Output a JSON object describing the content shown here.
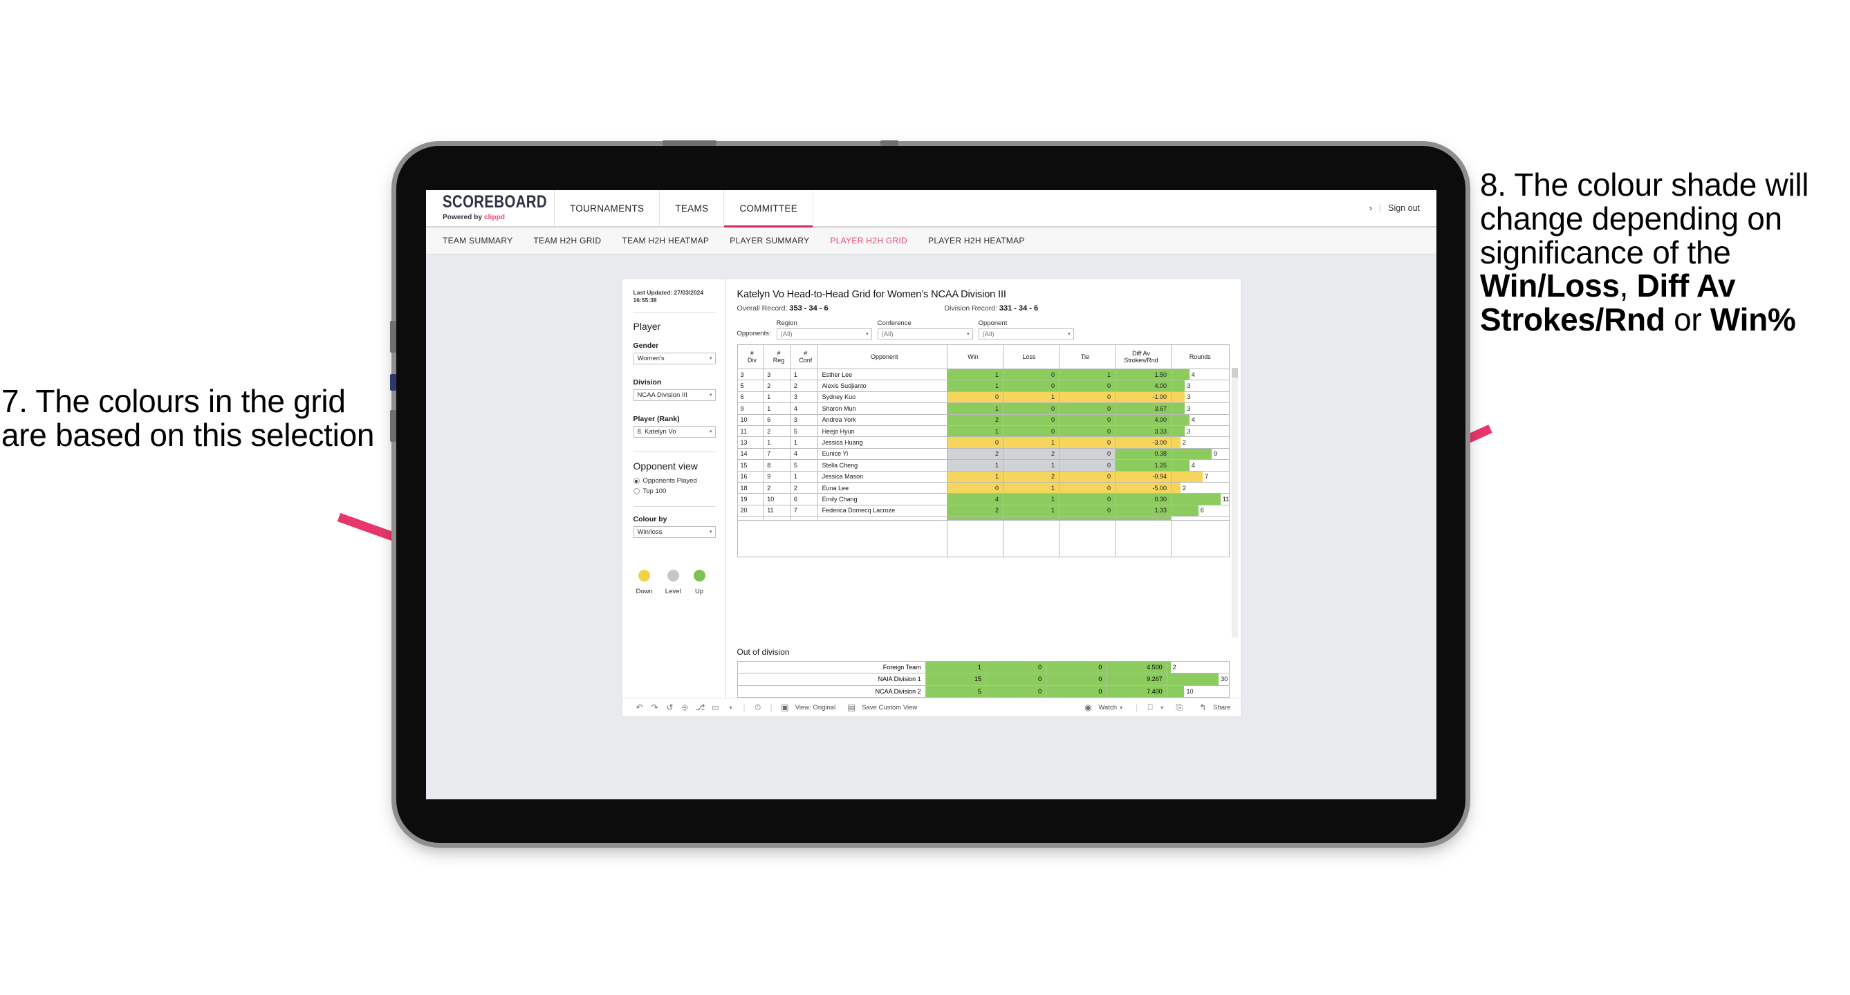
{
  "annotations": {
    "left": "7. The colours in the grid are based on this selection",
    "right_pre": "8. The colour shade will change depending on significance of the ",
    "right_b1": "Win/Loss",
    "right_mid1": ", ",
    "right_b2": "Diff Av Strokes/Rnd",
    "right_mid2": " or ",
    "right_b3": "Win%",
    "arrow_color": "#e8366b"
  },
  "topnav": {
    "brand_title": "SCOREBOARD",
    "brand_sub_prefix": "Powered by ",
    "brand_sub_name": "clippd",
    "items": [
      {
        "label": "TOURNAMENTS",
        "active": false
      },
      {
        "label": "TEAMS",
        "active": false
      },
      {
        "label": "COMMITTEE",
        "active": true
      }
    ],
    "chevron": "›",
    "divider": "|",
    "signout": "Sign out"
  },
  "subnav": {
    "items": [
      {
        "label": "TEAM SUMMARY",
        "active": false
      },
      {
        "label": "TEAM H2H GRID",
        "active": false
      },
      {
        "label": "TEAM H2H HEATMAP",
        "active": false
      },
      {
        "label": "PLAYER SUMMARY",
        "active": false
      },
      {
        "label": "PLAYER H2H GRID",
        "active": true
      },
      {
        "label": "PLAYER H2H HEATMAP",
        "active": false
      }
    ]
  },
  "panel": {
    "last_updated": "Last Updated: 27/03/2024 16:55:38",
    "player_heading": "Player",
    "gender_label": "Gender",
    "gender_value": "Women's",
    "division_label": "Division",
    "division_value": "NCAA Division III",
    "player_rank_label": "Player (Rank)",
    "player_rank_value": "8. Katelyn Vo",
    "opponent_view_heading": "Opponent view",
    "opponent_view_options": [
      {
        "label": "Opponents Played",
        "selected": true
      },
      {
        "label": "Top 100",
        "selected": false
      }
    ],
    "colour_by_label": "Colour by",
    "colour_by_value": "Win/loss",
    "legend": [
      {
        "label": "Down",
        "color": "#f2d247"
      },
      {
        "label": "Level",
        "color": "#c4c8cb"
      },
      {
        "label": "Up",
        "color": "#7cc253"
      }
    ],
    "caret": "▾"
  },
  "main": {
    "title": "Katelyn Vo Head-to-Head Grid for Women’s NCAA Division III",
    "overall_record_label": "Overall Record: ",
    "overall_record_value": "353 - 34 - 6",
    "division_record_label": "Division Record: ",
    "division_record_value": "331 - 34 - 6",
    "opponents_label": "Opponents:",
    "opp_filters": [
      {
        "caption": "Region",
        "value": "(All)"
      },
      {
        "caption": "Conference",
        "value": "(All)"
      },
      {
        "caption": "Opponent",
        "value": "(All)"
      }
    ]
  },
  "chart_data": {
    "type": "table",
    "title": "Katelyn Vo Head-to-Head Grid for Women’s NCAA Division III",
    "columns": [
      "# Div",
      "# Reg",
      "# Conf",
      "Opponent",
      "Win",
      "Loss",
      "Tie",
      "Diff Av Strokes/Rnd",
      "Rounds"
    ],
    "column_headers_multiline": [
      [
        "#",
        "Div"
      ],
      [
        "#",
        "Reg"
      ],
      [
        "#",
        "Conf"
      ],
      [
        "",
        "Opponent"
      ],
      [
        "",
        "Win"
      ],
      [
        "",
        "Loss"
      ],
      [
        "",
        "Tie"
      ],
      [
        "Diff Av",
        "Strokes/Rnd"
      ],
      [
        "",
        "Rounds"
      ]
    ],
    "rounds_max": 11,
    "colors": {
      "up": "#8ccc5e",
      "down": "#f5d55c",
      "level": "#cfd3d6",
      "none": "#ffffff"
    },
    "rows": [
      {
        "div": "3",
        "reg": "3",
        "conf": "1",
        "opponent": "Esther Lee",
        "win": "1",
        "loss": "0",
        "tie": "1",
        "diff": "1.50",
        "rounds": 4,
        "shade": "up"
      },
      {
        "div": "5",
        "reg": "2",
        "conf": "2",
        "opponent": "Alexis Sudjianto",
        "win": "1",
        "loss": "0",
        "tie": "0",
        "diff": "4.00",
        "rounds": 3,
        "shade": "up"
      },
      {
        "div": "6",
        "reg": "1",
        "conf": "3",
        "opponent": "Sydney Kuo",
        "win": "0",
        "loss": "1",
        "tie": "0",
        "diff": "-1.00",
        "rounds": 3,
        "shade": "down"
      },
      {
        "div": "9",
        "reg": "1",
        "conf": "4",
        "opponent": "Sharon Mun",
        "win": "1",
        "loss": "0",
        "tie": "0",
        "diff": "3.67",
        "rounds": 3,
        "shade": "up"
      },
      {
        "div": "10",
        "reg": "6",
        "conf": "3",
        "opponent": "Andrea York",
        "win": "2",
        "loss": "0",
        "tie": "0",
        "diff": "4.00",
        "rounds": 4,
        "shade": "up"
      },
      {
        "div": "11",
        "reg": "2",
        "conf": "5",
        "opponent": "Heejo Hyun",
        "win": "1",
        "loss": "0",
        "tie": "0",
        "diff": "3.33",
        "rounds": 3,
        "shade": "up"
      },
      {
        "div": "13",
        "reg": "1",
        "conf": "1",
        "opponent": "Jessica Huang",
        "win": "0",
        "loss": "1",
        "tie": "0",
        "diff": "-3.00",
        "rounds": 2,
        "shade": "down"
      },
      {
        "div": "14",
        "reg": "7",
        "conf": "4",
        "opponent": "Eunice Yi",
        "win": "2",
        "loss": "2",
        "tie": "0",
        "diff": "0.38",
        "rounds": 9,
        "shade": "level",
        "diff_shade": "up"
      },
      {
        "div": "15",
        "reg": "8",
        "conf": "5",
        "opponent": "Stella Cheng",
        "win": "1",
        "loss": "1",
        "tie": "0",
        "diff": "1.25",
        "rounds": 4,
        "shade": "level",
        "diff_shade": "up"
      },
      {
        "div": "16",
        "reg": "9",
        "conf": "1",
        "opponent": "Jessica Mason",
        "win": "1",
        "loss": "2",
        "tie": "0",
        "diff": "-0.94",
        "rounds": 7,
        "shade": "down"
      },
      {
        "div": "18",
        "reg": "2",
        "conf": "2",
        "opponent": "Euna Lee",
        "win": "0",
        "loss": "1",
        "tie": "0",
        "diff": "-5.00",
        "rounds": 2,
        "shade": "down"
      },
      {
        "div": "19",
        "reg": "10",
        "conf": "6",
        "opponent": "Emily Chang",
        "win": "4",
        "loss": "1",
        "tie": "0",
        "diff": "0.30",
        "rounds": 11,
        "shade": "up"
      },
      {
        "div": "20",
        "reg": "11",
        "conf": "7",
        "opponent": "Federica Domecq Lacroze",
        "win": "2",
        "loss": "1",
        "tie": "0",
        "diff": "1.33",
        "rounds": 6,
        "shade": "up"
      }
    ]
  },
  "out_of_division": {
    "title": "Out of division",
    "rounds_max": 30,
    "rows": [
      {
        "label": "Foreign Team",
        "win": "1",
        "loss": "0",
        "tie": "0",
        "diff": "4.500",
        "rounds": 2,
        "shade": "up"
      },
      {
        "label": "NAIA Division 1",
        "win": "15",
        "loss": "0",
        "tie": "0",
        "diff": "9.267",
        "rounds": 30,
        "shade": "up"
      },
      {
        "label": "NCAA Division 2",
        "win": "5",
        "loss": "0",
        "tie": "0",
        "diff": "7.400",
        "rounds": 10,
        "shade": "up"
      }
    ]
  },
  "toolbar": {
    "icons": [
      "undo-icon",
      "redo-icon",
      "revert-icon",
      "refresh-icon",
      "pause-icon",
      "shape-icon",
      "chevron-down-icon"
    ],
    "clock_icon": "clock-icon",
    "view_label": "View: Original",
    "save_label": "Save Custom View",
    "watch_label": "Watch",
    "share_label": "Share",
    "device_icon": "device-icon",
    "fullscreen_icon": "fullscreen-icon"
  }
}
